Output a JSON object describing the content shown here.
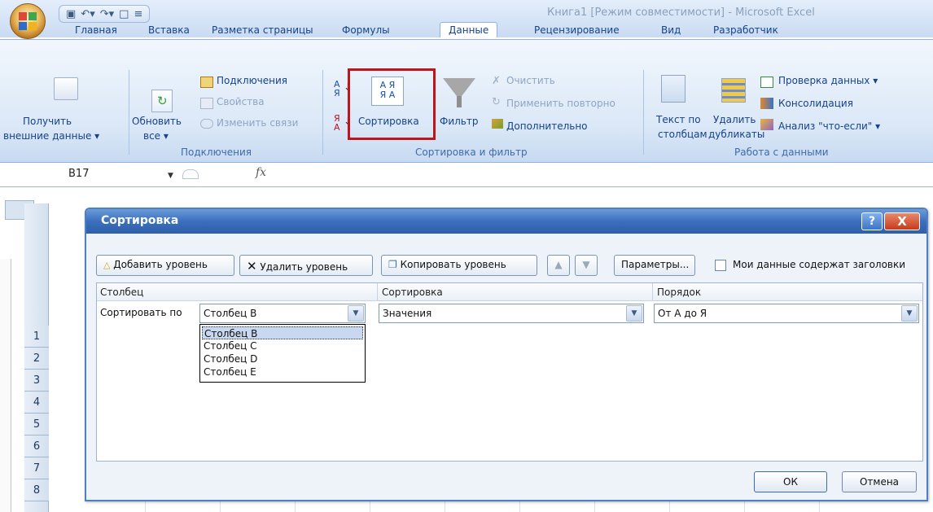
{
  "window": {
    "title": "Книга1  [Режим совместимости]  -  Microsoft Excel",
    "qat_icons": [
      "save-icon",
      "undo-icon",
      "redo-icon",
      "new-icon",
      "customize-icon"
    ]
  },
  "tabs": [
    {
      "label": "Главная"
    },
    {
      "label": "Вставка"
    },
    {
      "label": "Разметка страницы"
    },
    {
      "label": "Формулы"
    },
    {
      "label": "Данные",
      "active": true
    },
    {
      "label": "Рецензирование"
    },
    {
      "label": "Вид"
    },
    {
      "label": "Разработчик"
    }
  ],
  "ribbon": {
    "external": {
      "label": "Получить\nвнешние данные ▾",
      "line1": "Получить",
      "line2": "внешние данные ▾"
    },
    "connections": {
      "refresh_line1": "Обновить",
      "refresh_line2": "все ▾",
      "connections": "Подключения",
      "properties": "Свойства",
      "edit_links": "Изменить связи",
      "group": "Подключения"
    },
    "sortfilter": {
      "sort": "Сортировка",
      "filter": "Фильтр",
      "clear": "Очистить",
      "reapply": "Применить повторно",
      "advanced": "Дополнительно",
      "group": "Сортировка и фильтр"
    },
    "datatools": {
      "text_line1": "Текст по",
      "text_line2": "столбцам",
      "remove_line1": "Удалить",
      "remove_line2": "дубликаты",
      "validation": "Проверка данных ▾",
      "consolidate": "Консолидация",
      "whatif": "Анализ \"что-если\" ▾",
      "group": "Работа с данными"
    }
  },
  "formula_bar": {
    "name_box": "B17",
    "fx": "fx"
  },
  "row_numbers": [
    "1",
    "2",
    "3",
    "4",
    "5",
    "6",
    "7",
    "8"
  ],
  "dialog": {
    "title": "Сортировка",
    "help": "?",
    "close": "X",
    "add_level": "Добавить уровень",
    "delete_level": "Удалить уровень",
    "copy_level": "Копировать уровень",
    "up": "▲",
    "down": "▼",
    "options": "Параметры...",
    "headers_checkbox": "Мои данные содержат заголовки",
    "headers_checked": false,
    "columns": {
      "col": "Столбец",
      "sort": "Сортировка",
      "order": "Порядок"
    },
    "row": {
      "label": "Сортировать по",
      "column_value": "Столбец B",
      "sort_value": "Значения",
      "order_value": "От А до Я"
    },
    "dropdown_options": [
      "Столбец B",
      "Столбец C",
      "Столбец D",
      "Столбец E"
    ],
    "ok": "ОК",
    "cancel": "Отмена"
  },
  "colors": {
    "highlight": "#c0141c",
    "title_bar": "#3b6fbd",
    "ribbon": "#dbe8f7"
  }
}
